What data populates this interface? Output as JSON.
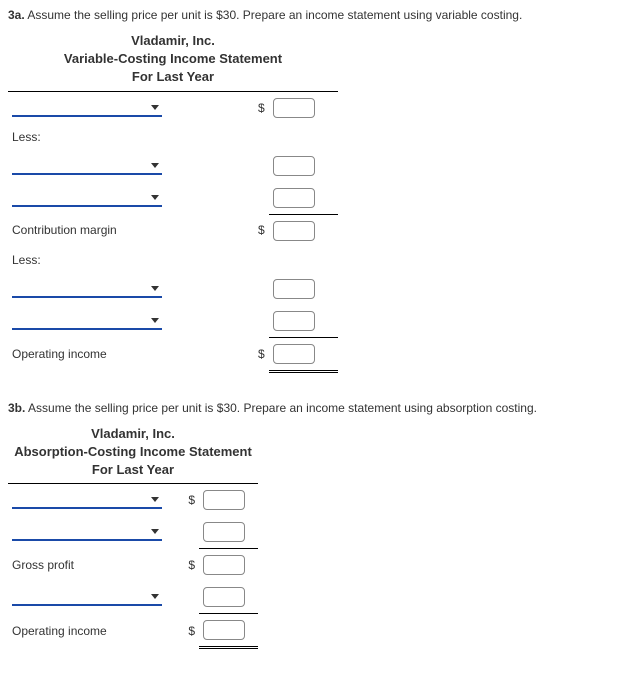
{
  "q3a": {
    "prompt_bold": "3a.",
    "prompt_text": " Assume the selling price per unit is $30. Prepare an income statement using variable costing.",
    "header_company": "Vladamir, Inc.",
    "header_title": "Variable-Costing Income Statement",
    "header_period": "For Last Year",
    "less1": "Less:",
    "contribution_margin": "Contribution margin",
    "less2": "Less:",
    "operating_income": "Operating income",
    "dollar": "$"
  },
  "q3b": {
    "prompt_bold": "3b.",
    "prompt_text": " Assume the selling price per unit is $30. Prepare an income statement using absorption costing.",
    "header_company": "Vladamir, Inc.",
    "header_title": "Absorption-Costing Income Statement",
    "header_period": "For Last Year",
    "gross_profit": "Gross profit",
    "operating_income": "Operating income",
    "dollar": "$"
  }
}
